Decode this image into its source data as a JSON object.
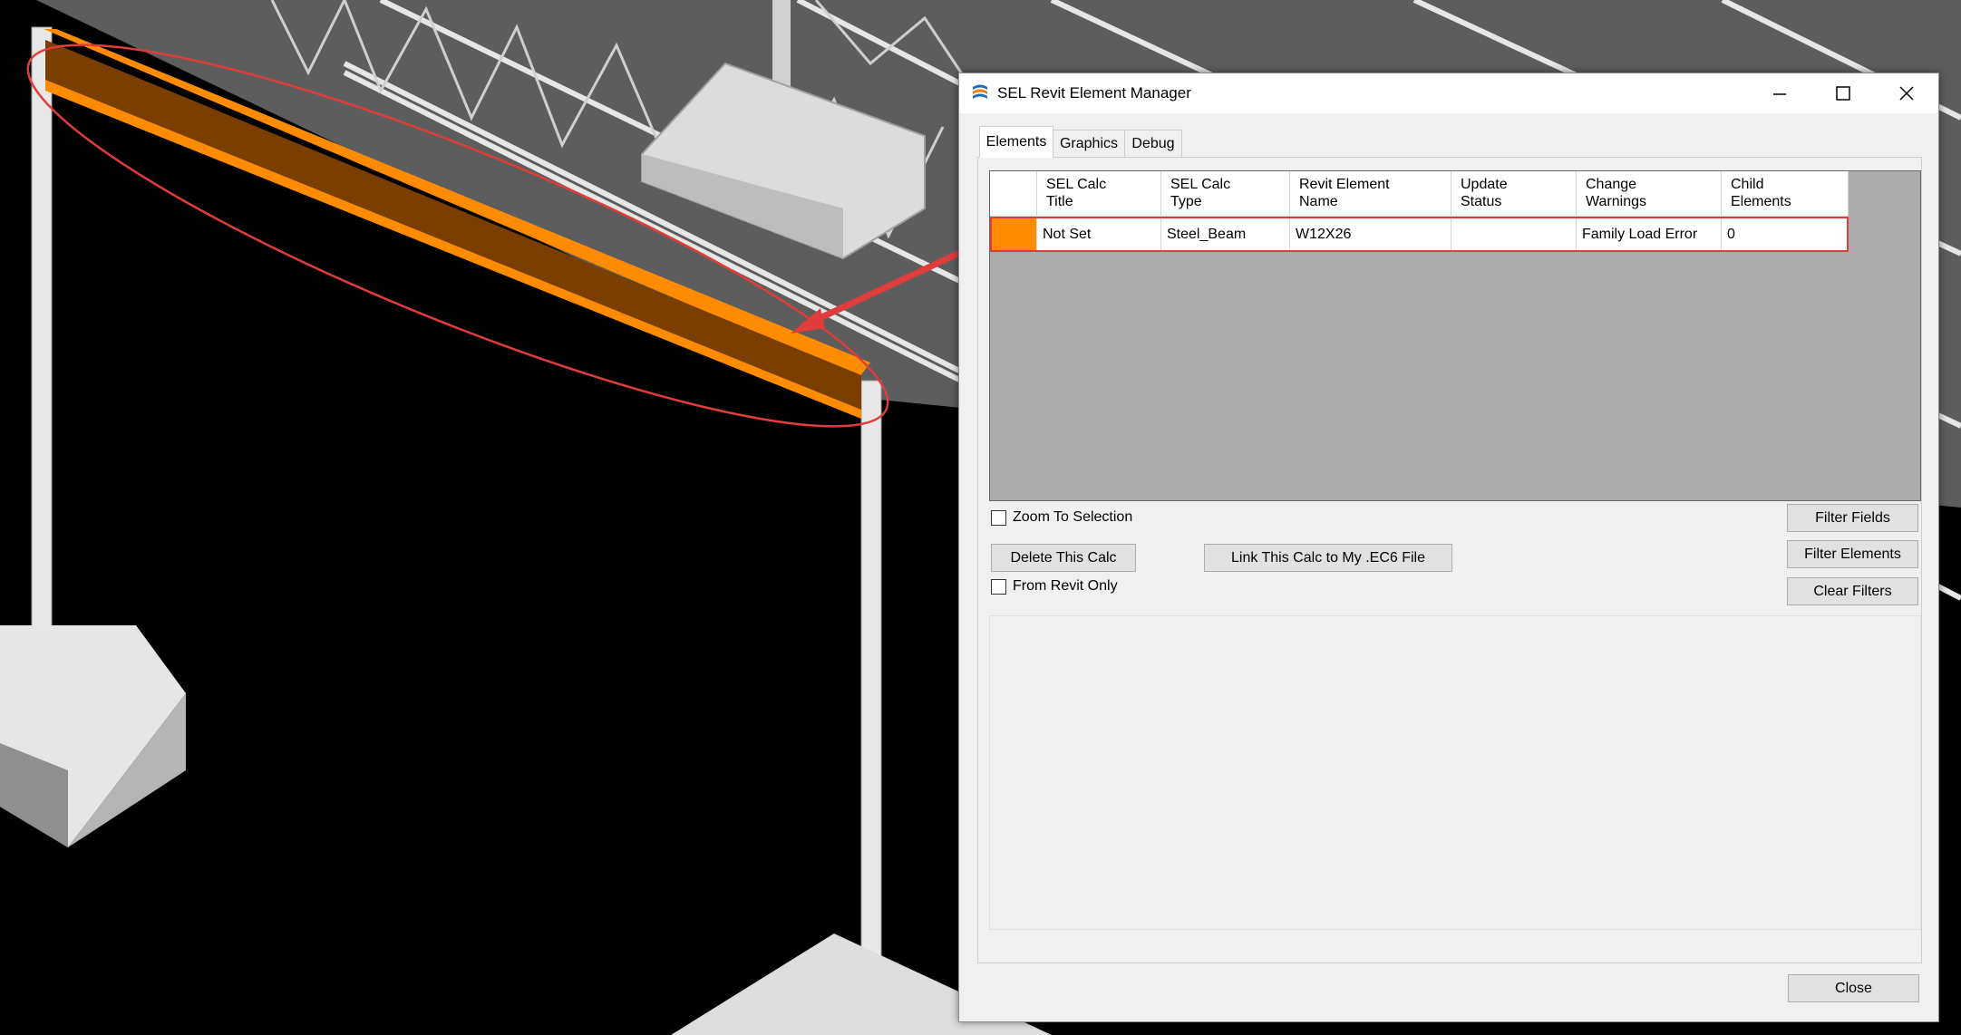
{
  "window": {
    "title": "SEL Revit Element Manager",
    "minimize_glyph": "—",
    "maximize_glyph": "☐",
    "close_glyph": "✕"
  },
  "tabs": [
    {
      "label": "Elements",
      "active": true
    },
    {
      "label": "Graphics",
      "active": false
    },
    {
      "label": "Debug",
      "active": false
    }
  ],
  "grid": {
    "columns": [
      {
        "line1": "SEL Calc",
        "line2": "Title"
      },
      {
        "line1": "SEL Calc",
        "line2": "Type"
      },
      {
        "line1": "Revit Element",
        "line2": "Name"
      },
      {
        "line1": "Update",
        "line2": "Status"
      },
      {
        "line1": "Change",
        "line2": "Warnings"
      },
      {
        "line1": "Child",
        "line2": "Elements"
      }
    ],
    "rows": [
      {
        "color": "#ff8c00",
        "title": "Not Set",
        "type": "Steel_Beam",
        "name": "W12X26",
        "status": "",
        "warnings": "Family Load Error",
        "children": "0"
      }
    ]
  },
  "controls": {
    "zoom_to_selection": "Zoom To Selection",
    "delete_calc": "Delete This Calc",
    "link_calc": "Link This Calc to My .EC6 File",
    "from_revit_only": "From Revit Only",
    "filter_fields": "Filter Fields",
    "filter_elements": "Filter Elements",
    "clear_filters": "Clear Filters",
    "close": "Close"
  },
  "colors": {
    "highlight": "#ff8c00",
    "annotation": "#e03c3c"
  }
}
